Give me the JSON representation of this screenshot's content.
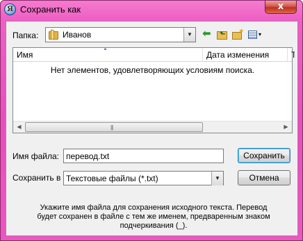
{
  "window": {
    "title": "Сохранить как",
    "app_icon_letter": "Я",
    "close_label": "x",
    "accent_color": "#e94dbd"
  },
  "toolbar": {
    "folder_label": "Папка:",
    "folder_value": "Иванов",
    "back_icon": "⬅",
    "up_folder_icon": "⬑",
    "new_folder_icon": "✶",
    "view_menu_icon": "▾"
  },
  "list": {
    "columns": [
      "Имя",
      "Дата изменения",
      "Т"
    ],
    "empty_message": "Нет элементов, удовлетворяющих условиям поиска.",
    "scroll_grip": "|||"
  },
  "form": {
    "filename_label": "Имя файла:",
    "filename_value": "перевод.txt",
    "saveas_label": "Сохранить в",
    "saveas_value": "Текстовые файлы (*.txt)",
    "save_button": "Сохранить",
    "cancel_button": "Отмена"
  },
  "hint": {
    "line1": "Укажите имя файла для сохранения исходного текста. Перевод",
    "line2": "будет сохранен в файле с тем же именем, предваренным знаком",
    "line3": "подчеркивания (_)."
  }
}
